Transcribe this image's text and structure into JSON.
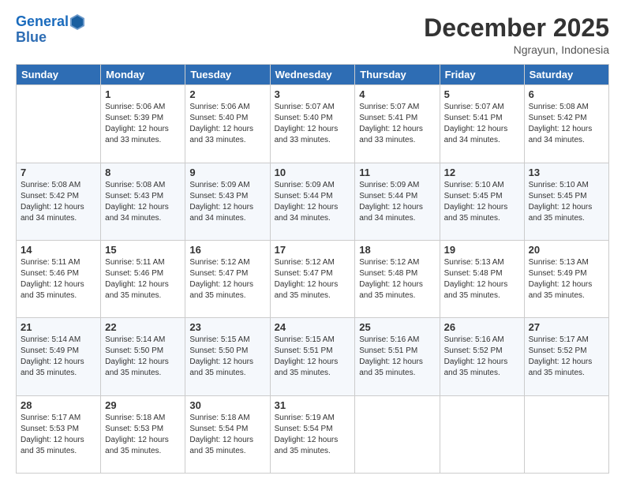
{
  "header": {
    "logo_line1": "General",
    "logo_line2": "Blue",
    "month_title": "December 2025",
    "subtitle": "Ngrayun, Indonesia"
  },
  "weekdays": [
    "Sunday",
    "Monday",
    "Tuesday",
    "Wednesday",
    "Thursday",
    "Friday",
    "Saturday"
  ],
  "weeks": [
    [
      {
        "day": "",
        "info": ""
      },
      {
        "day": "1",
        "info": "Sunrise: 5:06 AM\nSunset: 5:39 PM\nDaylight: 12 hours\nand 33 minutes."
      },
      {
        "day": "2",
        "info": "Sunrise: 5:06 AM\nSunset: 5:40 PM\nDaylight: 12 hours\nand 33 minutes."
      },
      {
        "day": "3",
        "info": "Sunrise: 5:07 AM\nSunset: 5:40 PM\nDaylight: 12 hours\nand 33 minutes."
      },
      {
        "day": "4",
        "info": "Sunrise: 5:07 AM\nSunset: 5:41 PM\nDaylight: 12 hours\nand 33 minutes."
      },
      {
        "day": "5",
        "info": "Sunrise: 5:07 AM\nSunset: 5:41 PM\nDaylight: 12 hours\nand 34 minutes."
      },
      {
        "day": "6",
        "info": "Sunrise: 5:08 AM\nSunset: 5:42 PM\nDaylight: 12 hours\nand 34 minutes."
      }
    ],
    [
      {
        "day": "7",
        "info": "Sunrise: 5:08 AM\nSunset: 5:42 PM\nDaylight: 12 hours\nand 34 minutes."
      },
      {
        "day": "8",
        "info": "Sunrise: 5:08 AM\nSunset: 5:43 PM\nDaylight: 12 hours\nand 34 minutes."
      },
      {
        "day": "9",
        "info": "Sunrise: 5:09 AM\nSunset: 5:43 PM\nDaylight: 12 hours\nand 34 minutes."
      },
      {
        "day": "10",
        "info": "Sunrise: 5:09 AM\nSunset: 5:44 PM\nDaylight: 12 hours\nand 34 minutes."
      },
      {
        "day": "11",
        "info": "Sunrise: 5:09 AM\nSunset: 5:44 PM\nDaylight: 12 hours\nand 34 minutes."
      },
      {
        "day": "12",
        "info": "Sunrise: 5:10 AM\nSunset: 5:45 PM\nDaylight: 12 hours\nand 35 minutes."
      },
      {
        "day": "13",
        "info": "Sunrise: 5:10 AM\nSunset: 5:45 PM\nDaylight: 12 hours\nand 35 minutes."
      }
    ],
    [
      {
        "day": "14",
        "info": "Sunrise: 5:11 AM\nSunset: 5:46 PM\nDaylight: 12 hours\nand 35 minutes."
      },
      {
        "day": "15",
        "info": "Sunrise: 5:11 AM\nSunset: 5:46 PM\nDaylight: 12 hours\nand 35 minutes."
      },
      {
        "day": "16",
        "info": "Sunrise: 5:12 AM\nSunset: 5:47 PM\nDaylight: 12 hours\nand 35 minutes."
      },
      {
        "day": "17",
        "info": "Sunrise: 5:12 AM\nSunset: 5:47 PM\nDaylight: 12 hours\nand 35 minutes."
      },
      {
        "day": "18",
        "info": "Sunrise: 5:12 AM\nSunset: 5:48 PM\nDaylight: 12 hours\nand 35 minutes."
      },
      {
        "day": "19",
        "info": "Sunrise: 5:13 AM\nSunset: 5:48 PM\nDaylight: 12 hours\nand 35 minutes."
      },
      {
        "day": "20",
        "info": "Sunrise: 5:13 AM\nSunset: 5:49 PM\nDaylight: 12 hours\nand 35 minutes."
      }
    ],
    [
      {
        "day": "21",
        "info": "Sunrise: 5:14 AM\nSunset: 5:49 PM\nDaylight: 12 hours\nand 35 minutes."
      },
      {
        "day": "22",
        "info": "Sunrise: 5:14 AM\nSunset: 5:50 PM\nDaylight: 12 hours\nand 35 minutes."
      },
      {
        "day": "23",
        "info": "Sunrise: 5:15 AM\nSunset: 5:50 PM\nDaylight: 12 hours\nand 35 minutes."
      },
      {
        "day": "24",
        "info": "Sunrise: 5:15 AM\nSunset: 5:51 PM\nDaylight: 12 hours\nand 35 minutes."
      },
      {
        "day": "25",
        "info": "Sunrise: 5:16 AM\nSunset: 5:51 PM\nDaylight: 12 hours\nand 35 minutes."
      },
      {
        "day": "26",
        "info": "Sunrise: 5:16 AM\nSunset: 5:52 PM\nDaylight: 12 hours\nand 35 minutes."
      },
      {
        "day": "27",
        "info": "Sunrise: 5:17 AM\nSunset: 5:52 PM\nDaylight: 12 hours\nand 35 minutes."
      }
    ],
    [
      {
        "day": "28",
        "info": "Sunrise: 5:17 AM\nSunset: 5:53 PM\nDaylight: 12 hours\nand 35 minutes."
      },
      {
        "day": "29",
        "info": "Sunrise: 5:18 AM\nSunset: 5:53 PM\nDaylight: 12 hours\nand 35 minutes."
      },
      {
        "day": "30",
        "info": "Sunrise: 5:18 AM\nSunset: 5:54 PM\nDaylight: 12 hours\nand 35 minutes."
      },
      {
        "day": "31",
        "info": "Sunrise: 5:19 AM\nSunset: 5:54 PM\nDaylight: 12 hours\nand 35 minutes."
      },
      {
        "day": "",
        "info": ""
      },
      {
        "day": "",
        "info": ""
      },
      {
        "day": "",
        "info": ""
      }
    ]
  ]
}
